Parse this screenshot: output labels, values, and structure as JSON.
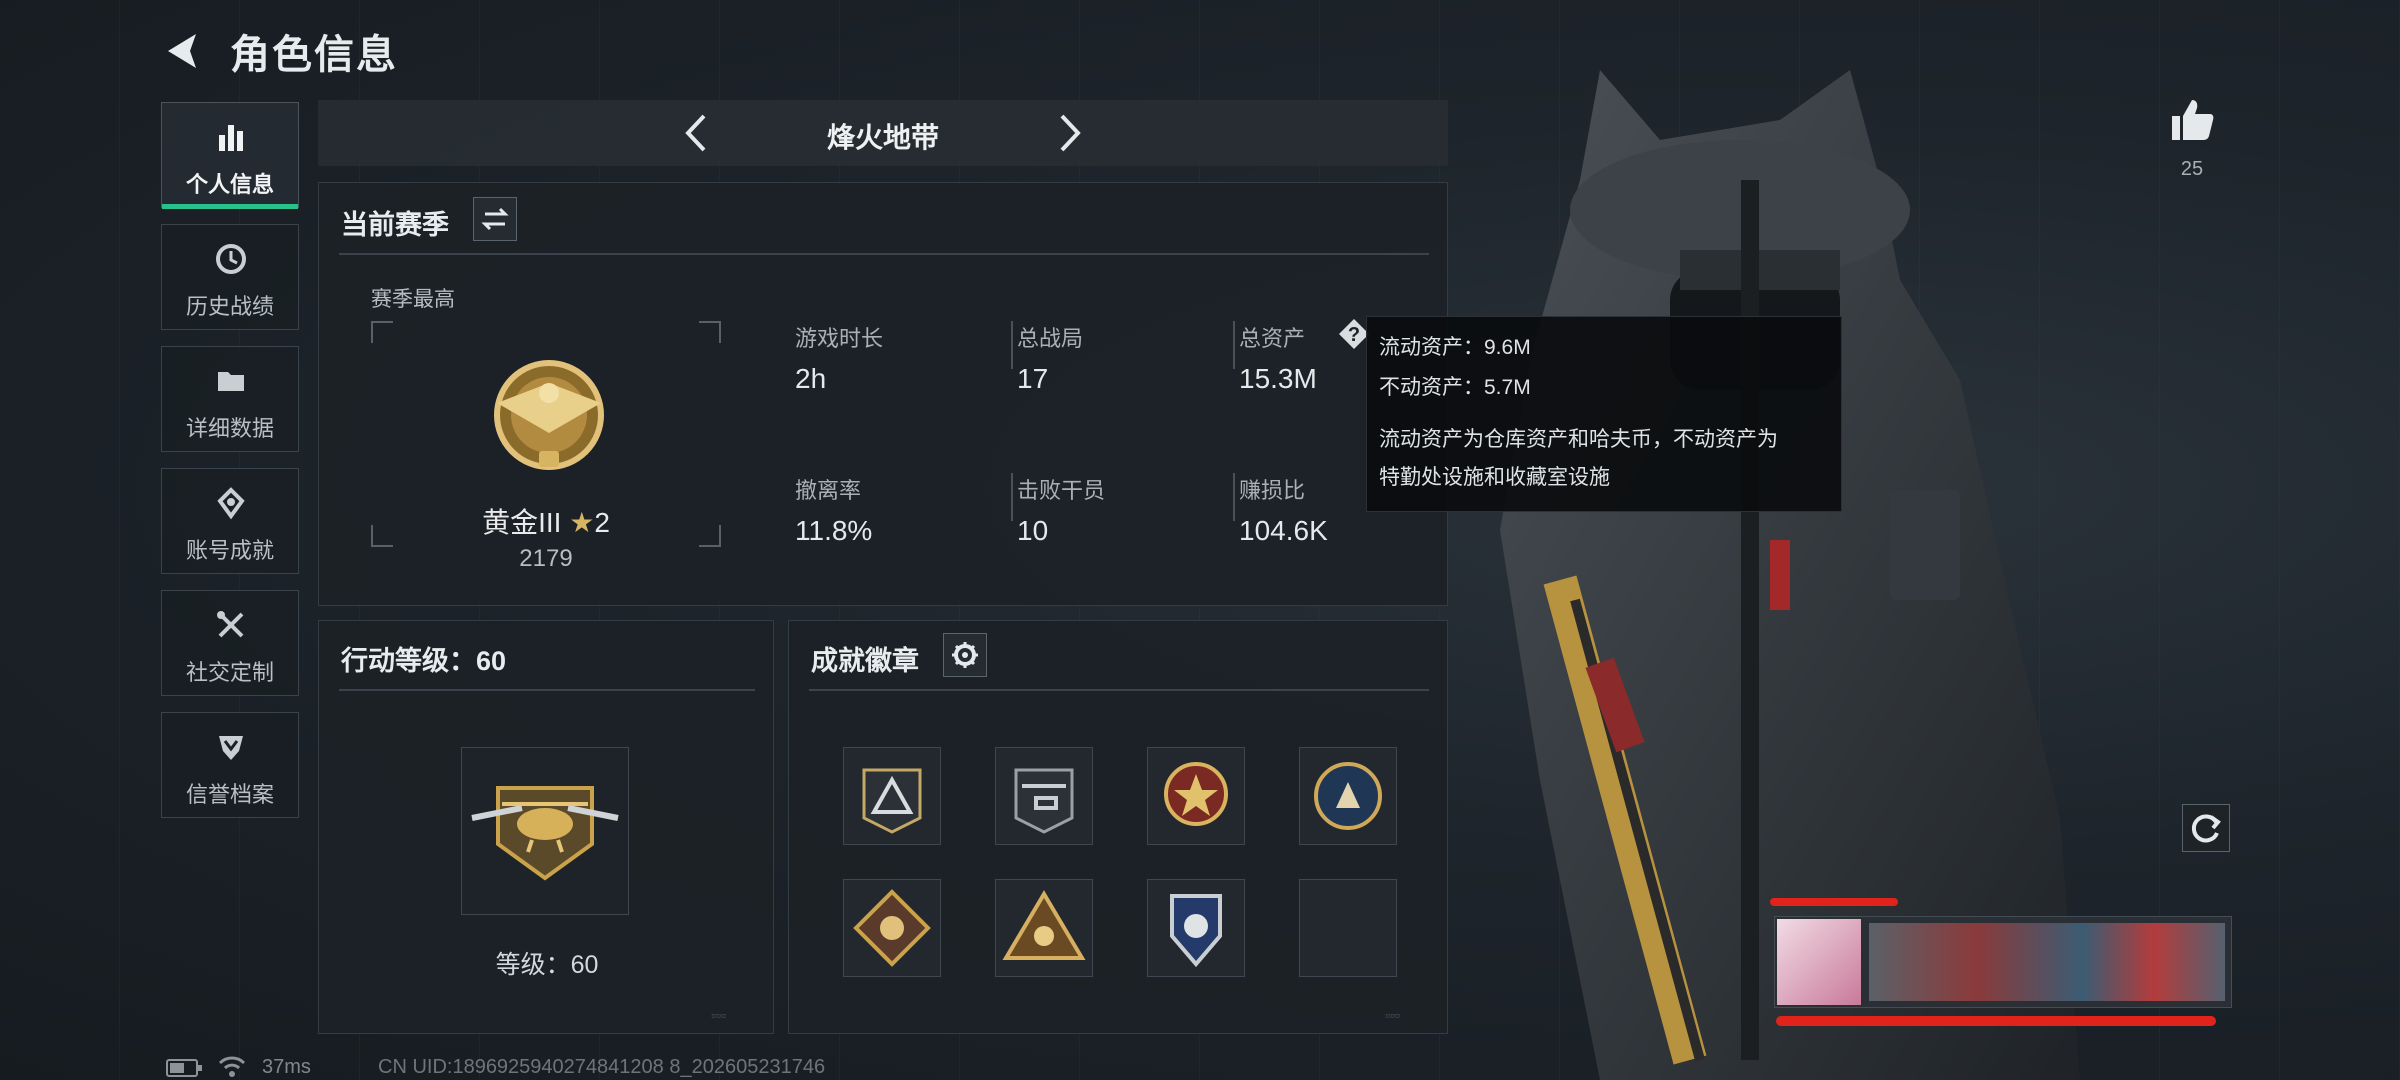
{
  "header": {
    "title": "角色信息"
  },
  "nav": {
    "items": [
      {
        "label": "个人信息",
        "icon": "bar-chart-icon",
        "active": true
      },
      {
        "label": "历史战绩",
        "icon": "clock-icon"
      },
      {
        "label": "详细数据",
        "icon": "folder-icon"
      },
      {
        "label": "账号成就",
        "icon": "achievement-icon"
      },
      {
        "label": "社交定制",
        "icon": "tools-icon"
      },
      {
        "label": "信誉档案",
        "icon": "shield-icon"
      }
    ]
  },
  "mode": {
    "label": "烽火地带"
  },
  "season": {
    "title": "当前赛季",
    "best_label": "赛季最高",
    "rank_name": "黄金III",
    "rank_stars": "2",
    "rank_points": "2179",
    "stats": [
      {
        "label": "游戏时长",
        "value": "2h"
      },
      {
        "label": "总战局",
        "value": "17"
      },
      {
        "label": "总资产",
        "value": "15.3M"
      },
      {
        "label": "撤离率",
        "value": "11.8%"
      },
      {
        "label": "击败干员",
        "value": "10"
      },
      {
        "label": "赚损比",
        "value": "104.6K"
      }
    ]
  },
  "tooltip": {
    "line1": "流动资产：9.6M",
    "line2": "不动资产：5.7M",
    "line3": "流动资产为仓库资产和哈夫币，不动资产为",
    "line4": "特勤处设施和收藏室设施"
  },
  "level": {
    "title": "行动等级：60",
    "level_text": "等级：60"
  },
  "badges": {
    "title": "成就徽章"
  },
  "likes": {
    "count": "25"
  },
  "status": {
    "ping": "37ms",
    "uid": "CN UID:1896925940274841208 8_202605231746"
  },
  "colors": {
    "accent": "#27c28a",
    "gold": "#c9a24a",
    "redaction": "#e0241b"
  }
}
